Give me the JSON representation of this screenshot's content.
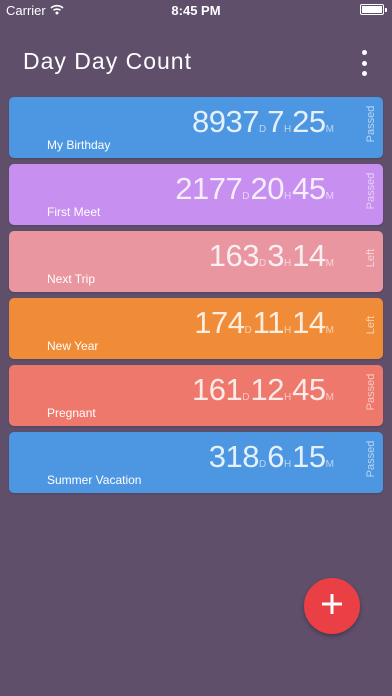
{
  "status_bar": {
    "carrier": "Carrier",
    "time": "8:45 PM",
    "battery_level": 1.0
  },
  "header": {
    "title": "Day Day Count",
    "menu_icon": "more-vertical-icon"
  },
  "colors": {
    "background": "#5f4f6b",
    "fab": "#ea3f44"
  },
  "cards": [
    {
      "name": "My Birthday",
      "days": "8937",
      "hours": "7",
      "minutes": "25",
      "status": "Passed",
      "color": "#4d97e2",
      "d_unit": "D",
      "h_unit": "H",
      "m_unit": "M"
    },
    {
      "name": "First Meet",
      "days": "2177",
      "hours": "20",
      "minutes": "45",
      "status": "Passed",
      "color": "#c68ff0",
      "d_unit": "D",
      "h_unit": "H",
      "m_unit": "M"
    },
    {
      "name": "Next Trip",
      "days": "163",
      "hours": "3",
      "minutes": "14",
      "status": "Left",
      "color": "#ea96a1",
      "d_unit": "D",
      "h_unit": "H",
      "m_unit": "M"
    },
    {
      "name": "New Year",
      "days": "174",
      "hours": "11",
      "minutes": "14",
      "status": "Left",
      "color": "#f08c37",
      "d_unit": "D",
      "h_unit": "H",
      "m_unit": "M"
    },
    {
      "name": "Pregnant",
      "days": "161",
      "hours": "12",
      "minutes": "45",
      "status": "Passed",
      "color": "#ef786c",
      "d_unit": "D",
      "h_unit": "H",
      "m_unit": "M"
    },
    {
      "name": "Summer Vacation",
      "days": "318",
      "hours": "6",
      "minutes": "15",
      "status": "Passed",
      "color": "#4d97e2",
      "d_unit": "D",
      "h_unit": "H",
      "m_unit": "M"
    }
  ],
  "fab": {
    "icon": "plus-icon"
  }
}
